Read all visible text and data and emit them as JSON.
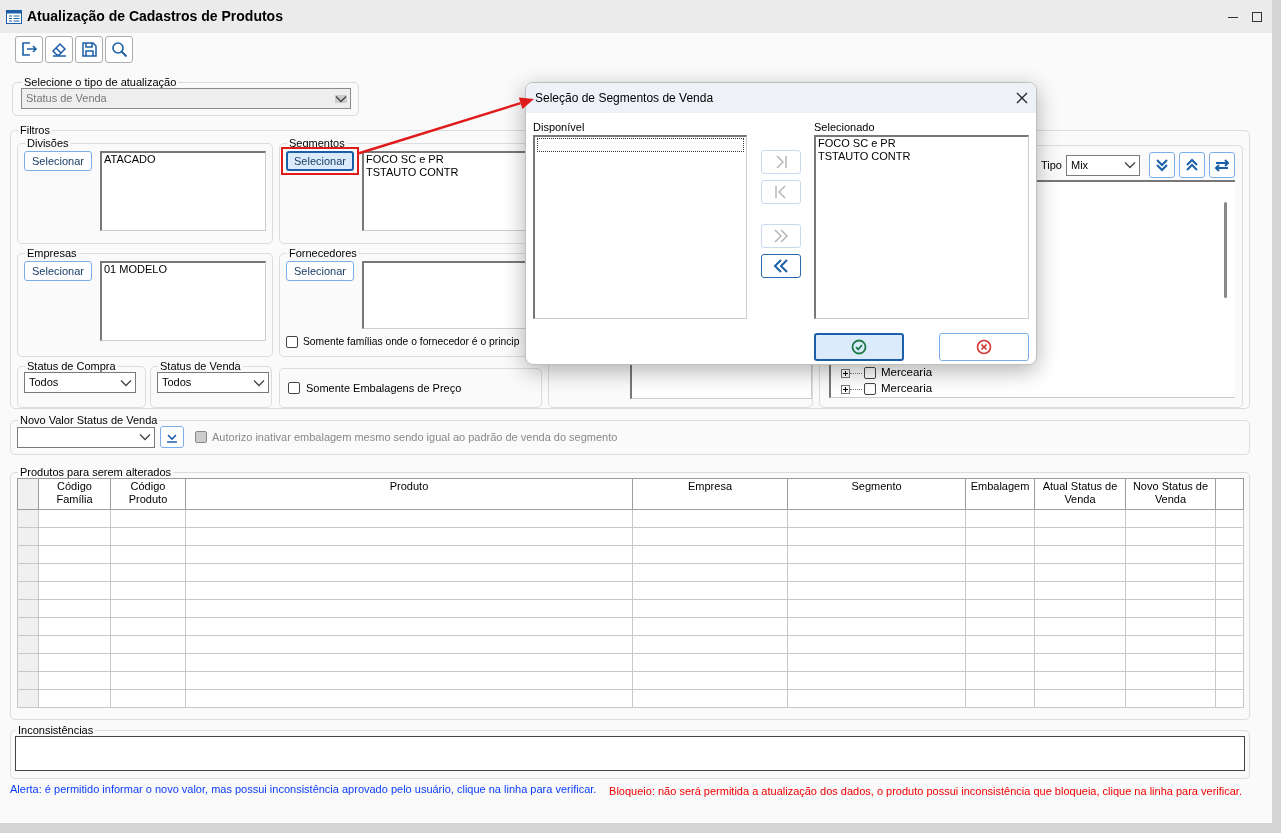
{
  "window": {
    "title": "Atualização de Cadastros de Produtos"
  },
  "toolbar": [
    {
      "kind": "exit"
    },
    {
      "kind": "clear"
    },
    {
      "kind": "save"
    },
    {
      "kind": "search"
    }
  ],
  "update_type": {
    "label": "Selecione o tipo de atualização",
    "value": "Status de Venda",
    "disabled": true
  },
  "filters": {
    "label": "Filtros",
    "divisoes": {
      "label": "Divisões",
      "button": "Selecionar",
      "items": [
        "ATACADO"
      ]
    },
    "segmentos": {
      "label": "Segmentos",
      "button": "Selecionar",
      "items": [
        "FOCO SC e PR",
        "TSTAUTO CONTR"
      ],
      "highlighted": true
    },
    "empresas": {
      "label": "Empresas",
      "button": "Selecionar",
      "items": [
        "01 MODELO"
      ]
    },
    "fornecedores": {
      "label": "Fornecedores",
      "button": "Selecionar",
      "checkbox": {
        "label": "Somente famílias onde o fornecedor é o princip",
        "checked": false
      }
    },
    "status_compra": {
      "label": "Status de Compra",
      "value": "Todos"
    },
    "status_venda": {
      "label": "Status de Venda",
      "value": "Todos"
    },
    "embalagens_checkbox": {
      "label": "Somente Embalagens de Preço",
      "checked": false
    },
    "tipo": {
      "label": "Tipo",
      "value": "Mix"
    },
    "tree_buttons": [
      {
        "kind": "expand_all"
      },
      {
        "kind": "collapse_all"
      },
      {
        "kind": "swap"
      }
    ],
    "tree": [
      {
        "label": "Mercearia",
        "checked": false,
        "expanded": false
      },
      {
        "label": "Mercearia",
        "checked": false,
        "expanded": false
      }
    ]
  },
  "new_value": {
    "label": "Novo Valor Status de Venda",
    "checkbox": {
      "label": "Autorizo inativar embalagem mesmo sendo igual ao padrão de venda do segmento",
      "checked": false,
      "disabled": true
    }
  },
  "products": {
    "label": "Produtos para serem alterados",
    "columns": [
      "Código Família",
      "Código Produto",
      "Produto",
      "Empresa",
      "Segmento",
      "Embalagem",
      "Atual Status de Venda",
      "Novo Status de Venda"
    ]
  },
  "inconsistencies": {
    "label": "Inconsistências"
  },
  "alerts": [
    {
      "kind": "alert",
      "text": "Alerta: é permitido informar o novo valor, mas possui inconsistência aprovado pelo usuário, clique na linha para verificar."
    },
    {
      "kind": "block",
      "text": "Bloqueio: não será permitida a atualização dos dados, o produto possui inconsistência que bloqueia, clique na linha para verificar."
    }
  ],
  "dialog": {
    "title": "Seleção de Segmentos de Venda",
    "available": {
      "label": "Disponível",
      "focus_outline": true
    },
    "selected": {
      "label": "Selecionado",
      "items": [
        "FOCO SC e PR",
        "TSTAUTO CONTR"
      ]
    },
    "transfer_buttons": [
      {
        "kind": "add",
        "disabled": true
      },
      {
        "kind": "remove",
        "disabled": true
      },
      {
        "kind": "add_all",
        "disabled": true
      },
      {
        "kind": "remove_all",
        "disabled": false
      }
    ],
    "actions": [
      {
        "kind": "ok",
        "focused": true
      },
      {
        "kind": "cancel",
        "focused": false
      }
    ]
  }
}
